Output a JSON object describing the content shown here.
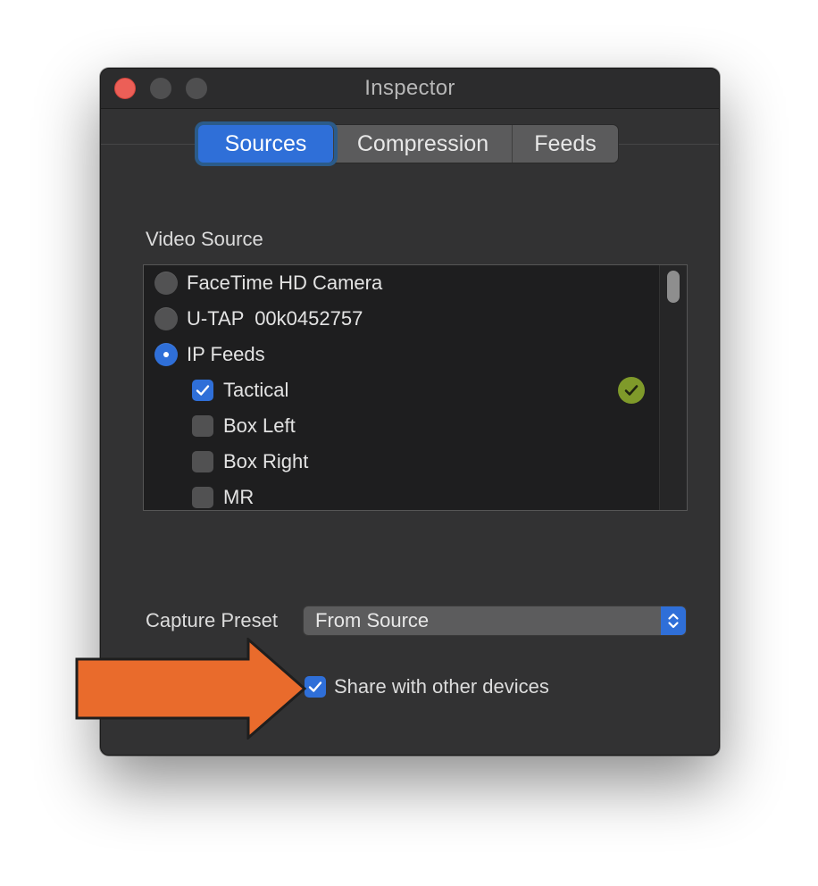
{
  "window": {
    "title": "Inspector"
  },
  "tabs": [
    {
      "label": "Sources",
      "selected": true
    },
    {
      "label": "Compression",
      "selected": false
    },
    {
      "label": "Feeds",
      "selected": false
    }
  ],
  "video_source": {
    "label": "Video Source",
    "items": [
      {
        "label": "FaceTime HD Camera",
        "type": "radio",
        "checked": false
      },
      {
        "label": "U-TAP  00k0452757",
        "type": "radio",
        "checked": false
      },
      {
        "label": "IP Feeds",
        "type": "radio",
        "checked": true
      },
      {
        "label": "Tactical",
        "type": "checkbox",
        "checked": true,
        "status_icon": "checkmark-circle-icon"
      },
      {
        "label": "Box Left",
        "type": "checkbox",
        "checked": false
      },
      {
        "label": "Box Right",
        "type": "checkbox",
        "checked": false
      },
      {
        "label": "MR",
        "type": "checkbox",
        "checked": false
      }
    ]
  },
  "capture_preset": {
    "label": "Capture Preset",
    "value": "From Source"
  },
  "share": {
    "label": "Share with other devices",
    "checked": true
  },
  "colors": {
    "accent": "#2f6fd8",
    "status_ok": "#7f9a2a",
    "annotation_arrow": "#e96b2c"
  }
}
